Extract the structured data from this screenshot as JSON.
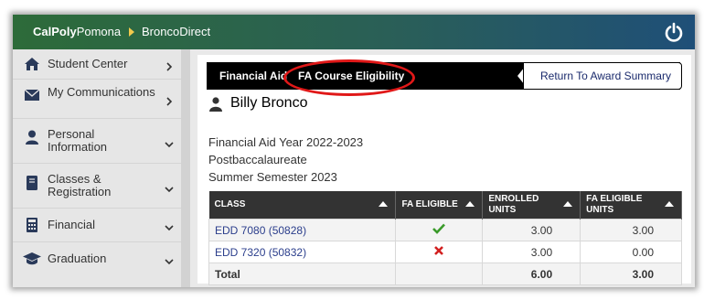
{
  "topbar": {
    "brand_bold": "CalPoly",
    "brand_regular": "Pomona",
    "app_name": "BroncoDirect",
    "power_icon": "power-icon"
  },
  "sidebar": {
    "items": [
      {
        "label": "Student Center",
        "icon": "home-icon",
        "arrow": "chevron-right-icon"
      },
      {
        "label": "My Communications",
        "icon": "envelope-icon",
        "arrow": "chevron-right-icon"
      },
      {
        "label": "Personal Information",
        "icon": "person-icon",
        "arrow": "chevron-down-icon"
      },
      {
        "label": "Classes & Registration",
        "icon": "book-icon",
        "arrow": "chevron-down-icon"
      },
      {
        "label": "Financial",
        "icon": "calculator-icon",
        "arrow": "chevron-down-icon"
      },
      {
        "label": "Graduation",
        "icon": "graduation-cap-icon",
        "arrow": "chevron-down-icon"
      }
    ]
  },
  "breadcrumb": {
    "item1": "Financial Aid",
    "item2": "FA Course Eligibility",
    "return_label": "Return To Award Summary"
  },
  "student": {
    "name": "Billy Bronco",
    "aid_year": "Financial Aid Year 2022-2023",
    "career": "Postbaccalaureate",
    "term": "Summer Semester 2023"
  },
  "table": {
    "headers": [
      "CLASS",
      "FA ELIGIBLE",
      "ENROLLED UNITS",
      "FA ELIGIBLE UNITS"
    ],
    "header_lines": [
      [
        "CLASS"
      ],
      [
        "FA ELIGIBLE"
      ],
      [
        "ENROLLED",
        "UNITS"
      ],
      [
        "FA ELIGIBLE",
        "UNITS"
      ]
    ],
    "rows": [
      {
        "class": "EDD 7080 (50828)",
        "eligible": "check-icon",
        "enrolled": "3.00",
        "eligible_units": "3.00"
      },
      {
        "class": "EDD 7320 (50832)",
        "eligible": "x-icon",
        "enrolled": "3.00",
        "eligible_units": "0.00"
      }
    ],
    "total": {
      "label": "Total",
      "enrolled": "6.00",
      "eligible_units": "3.00"
    }
  },
  "colors": {
    "topbar_start": "#2d6b39",
    "topbar_end": "#1f4f78",
    "highlight_circle": "#e01818",
    "check": "#3a9a2a",
    "x": "#d22020",
    "link": "#2b3e8c"
  }
}
